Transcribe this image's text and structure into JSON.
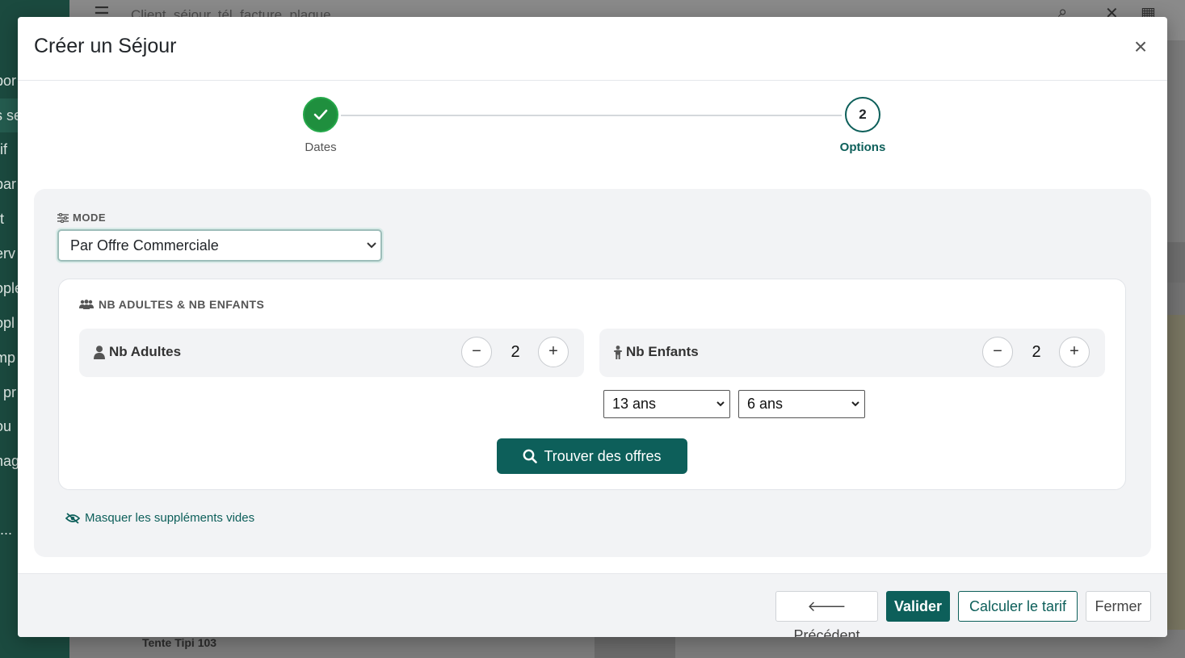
{
  "background": {
    "search_placeholder": "Client, séjour, tél, facture, plaque",
    "sidebar_fragments": [
      "por",
      "s se",
      "if",
      "par",
      "t",
      "erv",
      "ople",
      "opl",
      "mp",
      "pr",
      "ou",
      "nag",
      "..."
    ],
    "bottom_row_text": "Tente Tipi 103"
  },
  "modal": {
    "title": "Créer un Séjour",
    "close_label": "×"
  },
  "stepper": {
    "steps": [
      {
        "label": "Dates",
        "state": "completed"
      },
      {
        "number": "2",
        "label": "Options",
        "state": "active"
      }
    ]
  },
  "mode": {
    "label": "MODE",
    "selected": "Par Offre Commerciale"
  },
  "guests": {
    "title": "NB ADULTES & NB ENFANTS",
    "adults": {
      "label": "Nb Adultes",
      "value": "2",
      "minus": "−",
      "plus": "+"
    },
    "children": {
      "label": "Nb Enfants",
      "value": "2",
      "minus": "−",
      "plus": "+"
    },
    "child_ages": [
      "13 ans",
      "6 ans"
    ],
    "find_button": "Trouver des offres"
  },
  "hide_empty_link": "Masquer les suppléments vides",
  "footer": {
    "previous": "Précédent",
    "validate": "Valider",
    "calculate": "Calculer le tarif",
    "close": "Fermer"
  },
  "colors": {
    "primary": "#0d5f5a",
    "success": "#1f8f3e",
    "panel": "#f2f3f5"
  }
}
